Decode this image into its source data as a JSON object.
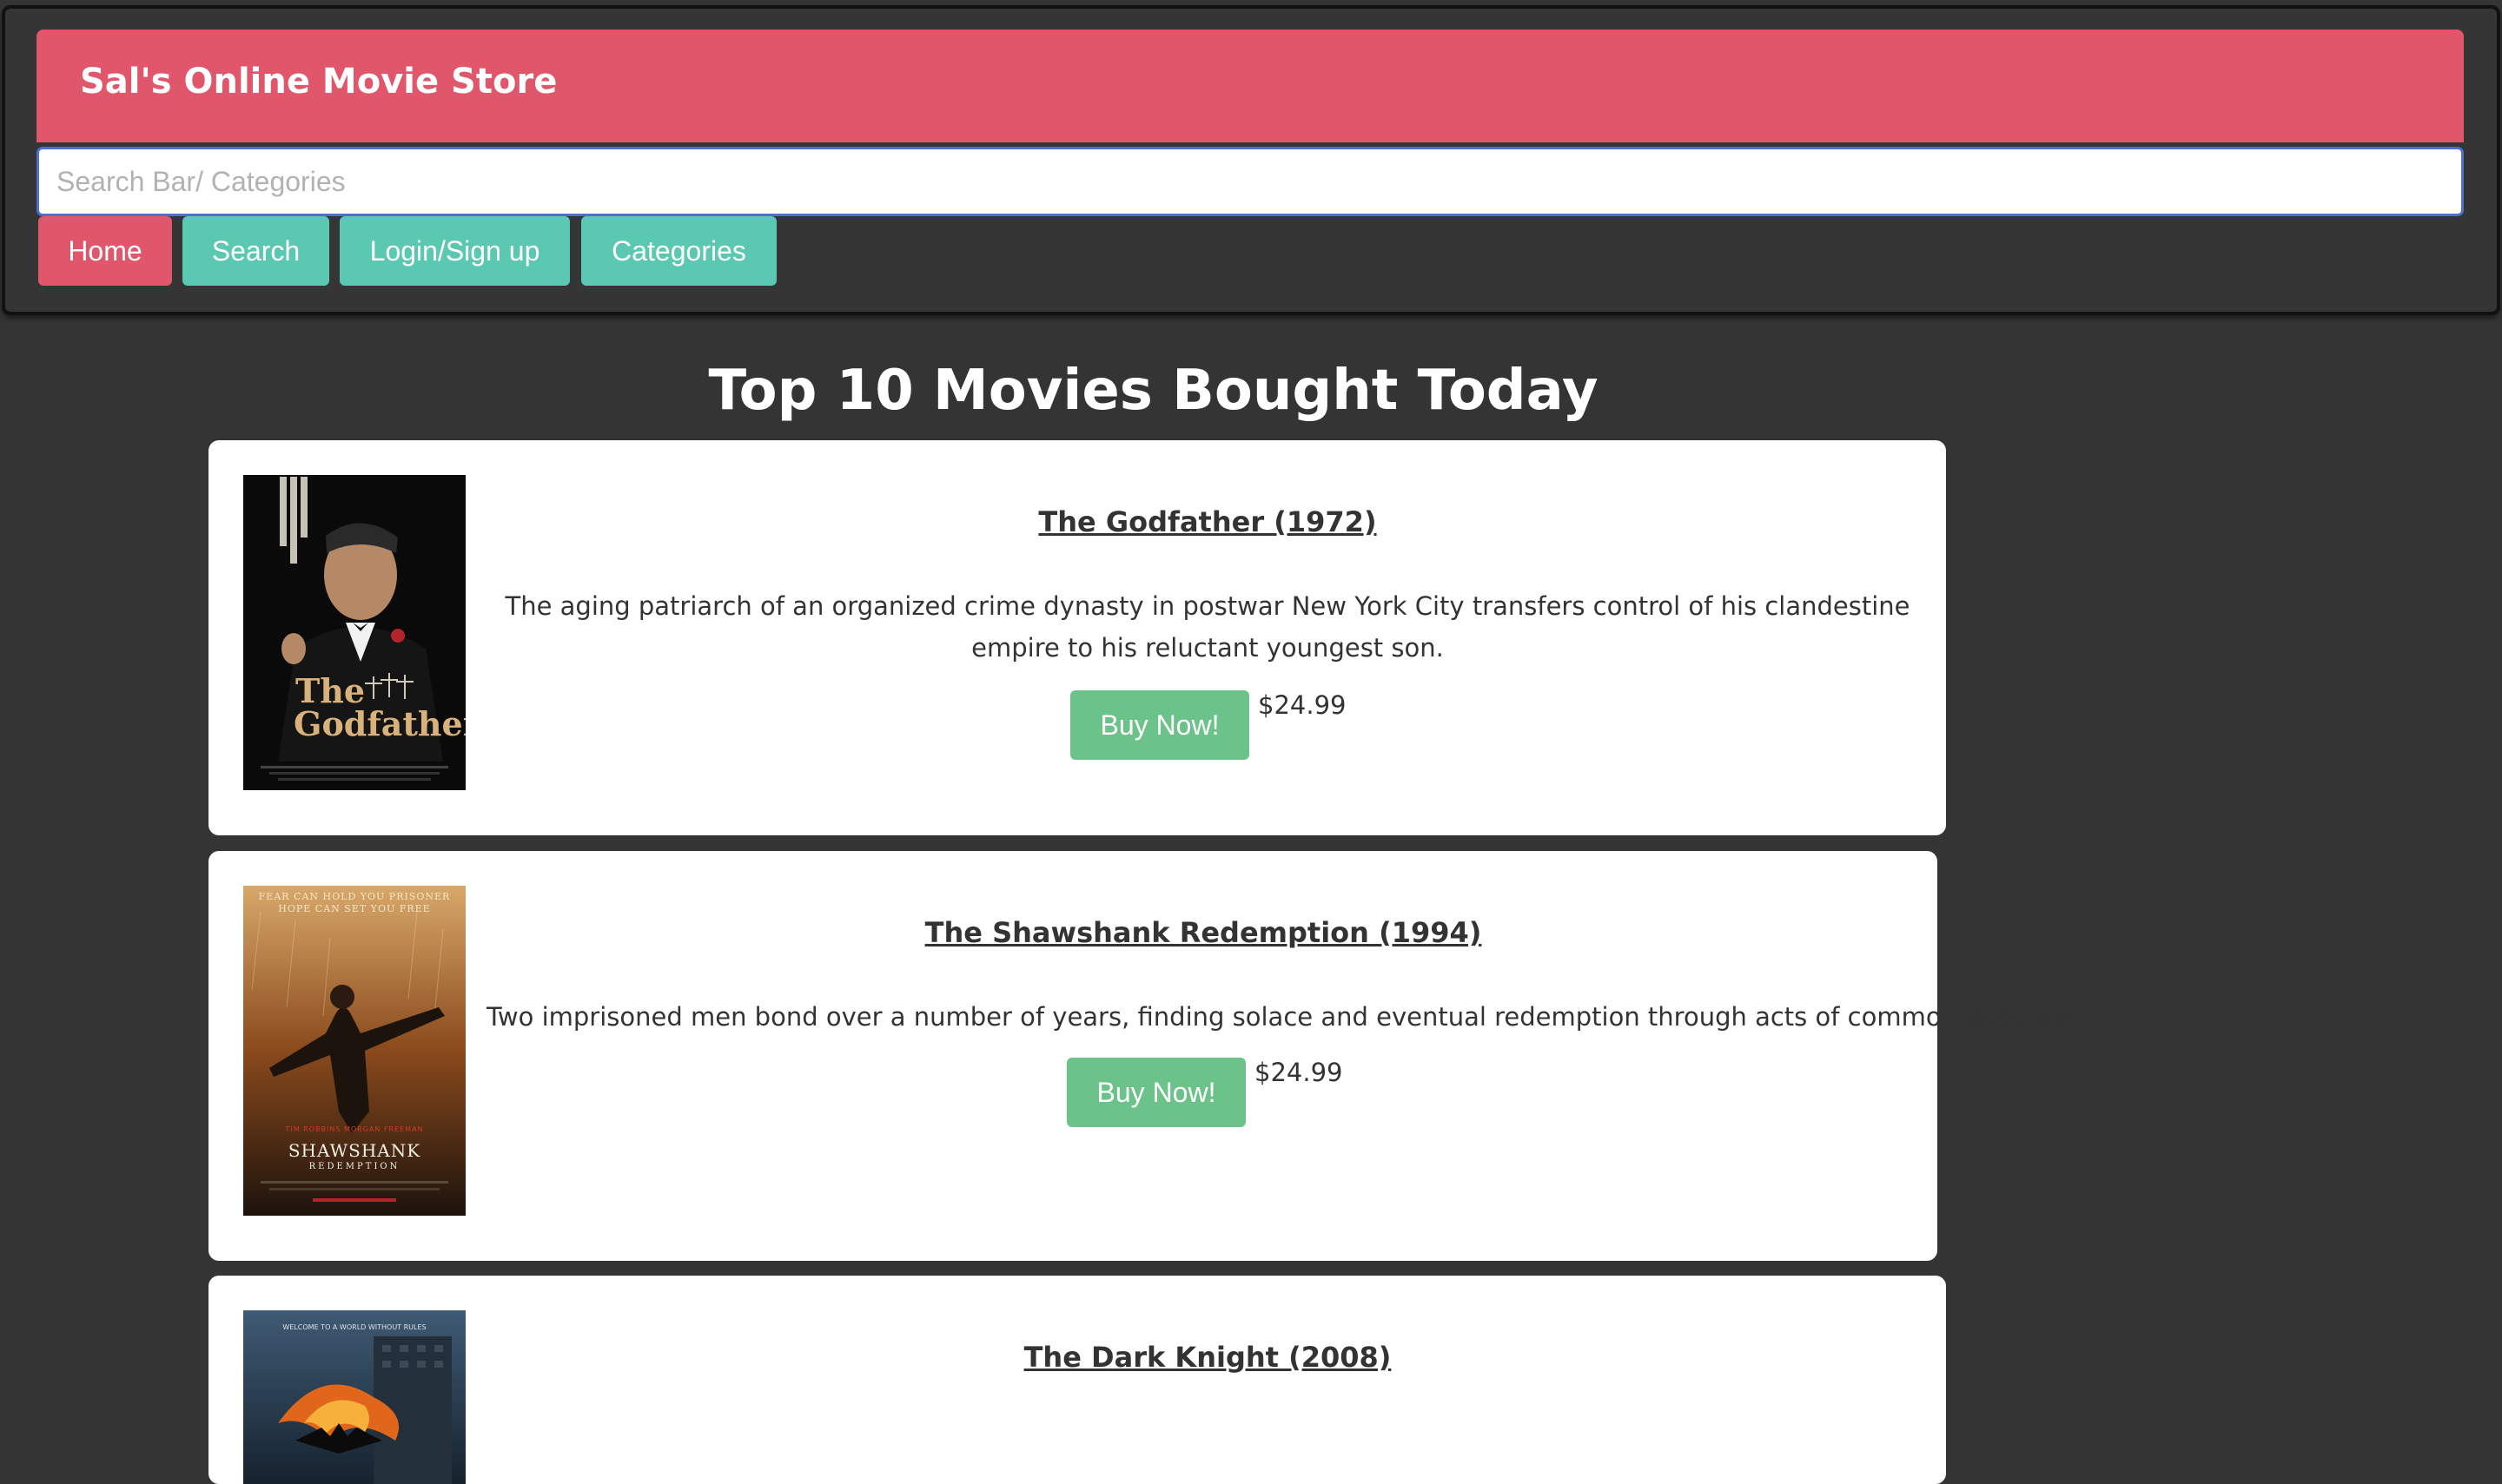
{
  "header": {
    "store_name": "Sal's Online Movie Store",
    "search_placeholder": "Search Bar/ Categories",
    "search_value": "",
    "nav": {
      "home": "Home",
      "search": "Search",
      "login": "Login/Sign up",
      "categories": "Categories"
    }
  },
  "main": {
    "heading": "Top 10 Movies Bought Today",
    "movies": [
      {
        "title": "The Godfather (1972)",
        "description": "The aging patriarch of an organized crime dynasty in postwar New York City transfers control of his clandestine empire to his reluctant youngest son.",
        "buy_label": "Buy Now!",
        "price": "$24.99",
        "poster": {
          "text_1": "The",
          "text_2": "Godfather",
          "bg": "#0a0a0a",
          "accent": "#d8b27a"
        }
      },
      {
        "title": "The Shawshank Redemption (1994)",
        "description": "Two imprisoned men bond over a number of years, finding solace and eventual redemption through acts of common decency.",
        "buy_label": "Buy Now!",
        "price": "$24.99",
        "poster": {
          "tagline_1": "FEAR CAN HOLD YOU PRISONER",
          "tagline_2": "HOPE CAN SET YOU FREE",
          "credits": "TIM ROBBINS    MORGAN FREEMAN",
          "text_1": "SHAWSHANK",
          "text_2": "REDEMPTION",
          "bg": "#8a4a1c"
        }
      },
      {
        "title": "The Dark Knight (2008)",
        "poster": {
          "tagline": "WELCOME TO A WORLD WITHOUT RULES",
          "bg": "#2a3c4e"
        }
      }
    ]
  },
  "colors": {
    "page_bg": "#343434",
    "brand": "#e0566b",
    "nav_teal": "#5bc8b2",
    "buy_green": "#6cc38a"
  }
}
